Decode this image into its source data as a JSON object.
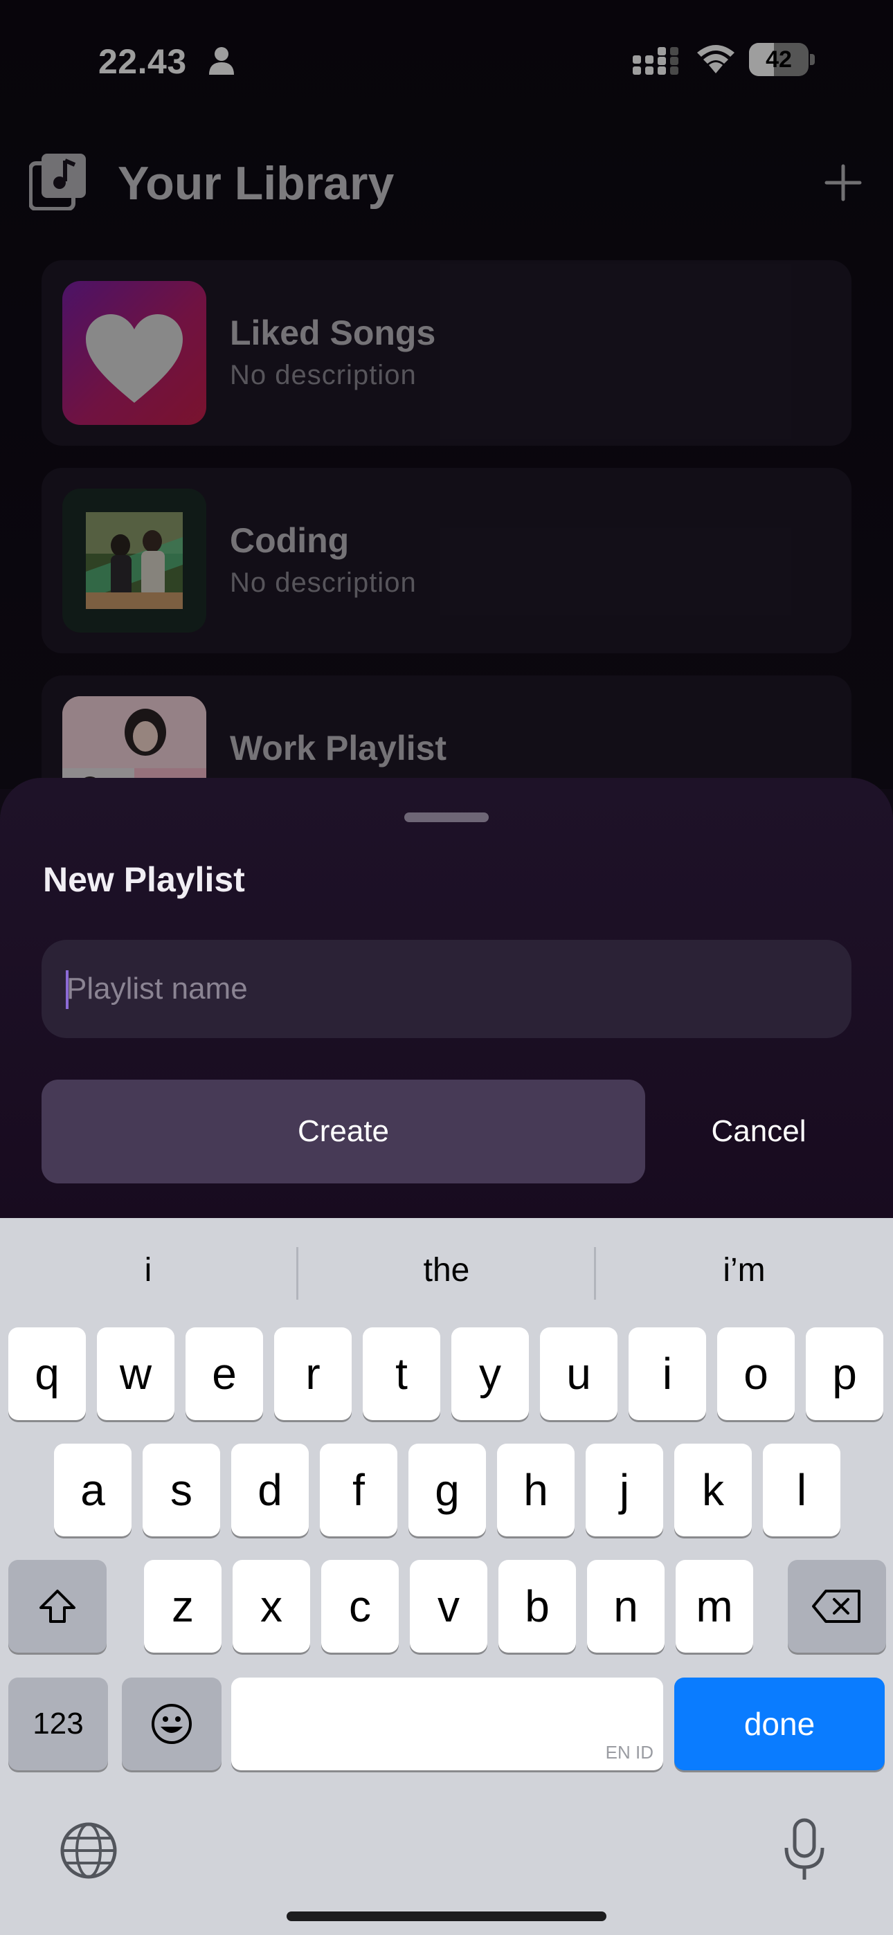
{
  "status_bar": {
    "time": "22.43",
    "battery_level": "42",
    "battery_fraction": 0.42
  },
  "library": {
    "title": "Your Library",
    "playlists": [
      {
        "name": "Liked Songs",
        "description": "No description",
        "art": "heart-gradient"
      },
      {
        "name": "Coding",
        "description": "No description",
        "art": "photo-two-people"
      },
      {
        "name": "Work Playlist",
        "description": "",
        "art": "photo-collage"
      }
    ]
  },
  "sheet": {
    "title": "New Playlist",
    "input_placeholder": "Playlist name",
    "input_value": "",
    "create_label": "Create",
    "cancel_label": "Cancel"
  },
  "keyboard": {
    "suggestions": [
      "i",
      "the",
      "i’m"
    ],
    "row1": [
      "q",
      "w",
      "e",
      "r",
      "t",
      "y",
      "u",
      "i",
      "o",
      "p"
    ],
    "row2": [
      "a",
      "s",
      "d",
      "f",
      "g",
      "h",
      "j",
      "k",
      "l"
    ],
    "row3": [
      "z",
      "x",
      "c",
      "v",
      "b",
      "n",
      "m"
    ],
    "numbers_label": "123",
    "space_lang": "EN ID",
    "done_label": "done"
  },
  "colors": {
    "accent_blue": "#0a7cff",
    "sheet_bg": "#1e1228",
    "create_button": "#473a56"
  }
}
